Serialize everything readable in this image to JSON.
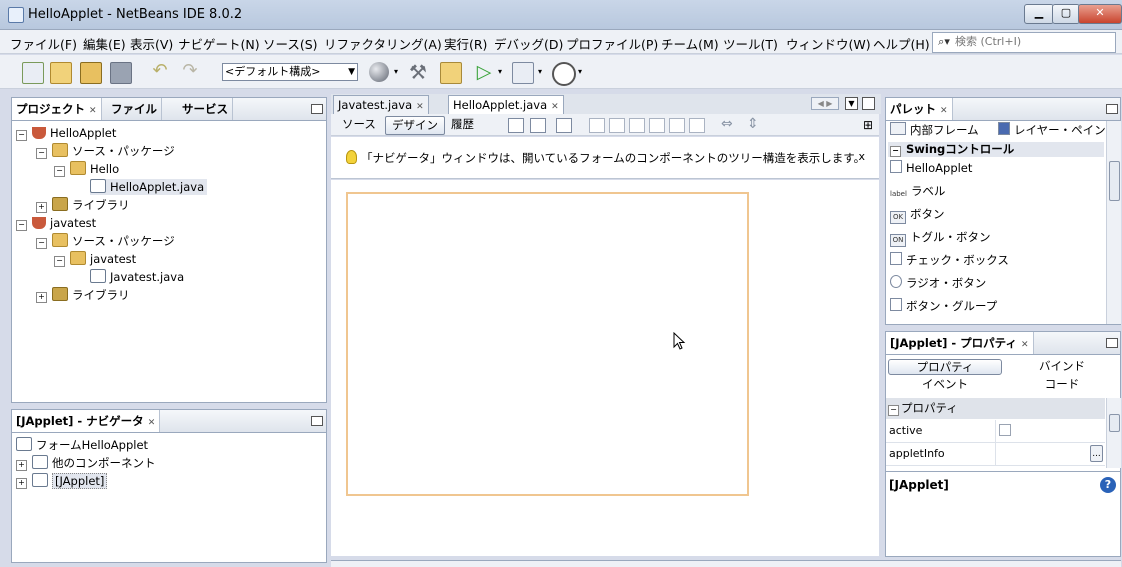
{
  "window": {
    "title": "HelloApplet - NetBeans IDE 8.0.2",
    "controls": {
      "minimize": "▁",
      "maximize": "▢",
      "close": "✕"
    }
  },
  "menubar": {
    "items": [
      "ファイル(F)",
      "編集(E)",
      "表示(V)",
      "ナビゲート(N)",
      "ソース(S)",
      "リファクタリング(A)",
      "実行(R)",
      "デバッグ(D)",
      "プロファイル(P)",
      "チーム(M)",
      "ツール(T)",
      "ウィンドウ(W)",
      "ヘルプ(H)"
    ],
    "search_placeholder": "検索 (Ctrl+I)"
  },
  "toolbar": {
    "config_selected": "<デフォルト構成>",
    "icons": [
      "new-file-icon",
      "new-project-icon",
      "open-project-icon",
      "save-all-icon",
      "undo-icon",
      "redo-icon",
      "browser-icon",
      "build-icon",
      "clean-build-icon",
      "run-icon",
      "debug-icon",
      "profile-icon"
    ]
  },
  "projects_panel": {
    "tabs": [
      "プロジェクト",
      "ファイル",
      "サービス"
    ],
    "tree": {
      "p1": "HelloApplet",
      "p1_src": "ソース・パッケージ",
      "p1_pkg": "Hello",
      "p1_file": "HelloApplet.java",
      "p1_lib": "ライブラリ",
      "p2": "javatest",
      "p2_src": "ソース・パッケージ",
      "p2_pkg": "javatest",
      "p2_file": "Javatest.java",
      "p2_lib": "ライブラリ"
    }
  },
  "navigator_panel": {
    "title": "[JApplet] - ナビゲータ",
    "tree": {
      "root": "フォームHelloApplet",
      "others": "他のコンポーネント",
      "japplet": "[JApplet]"
    }
  },
  "editor": {
    "tabs": [
      "Javatest.java",
      "HelloApplet.java"
    ],
    "active_tab": "HelloApplet.java",
    "views": [
      "ソース",
      "デザイン",
      "履歴"
    ],
    "active_view": "デザイン",
    "hint": "「ナビゲータ」ウィンドウは、開いているフォームのコンポーネントのツリー構造を表示します。",
    "hint_close": "x"
  },
  "palette_panel": {
    "title": "パレット",
    "top_items": [
      "内部フレーム",
      "レイヤー・ペイン"
    ],
    "category": "Swingコントロール",
    "items": [
      {
        "label": "HelloApplet",
        "icon": "file-icon"
      },
      {
        "label": "ラベル",
        "icon": "label-icon"
      },
      {
        "label": "ボタン",
        "icon": "button-icon"
      },
      {
        "label": "トグル・ボタン",
        "icon": "toggle-icon"
      },
      {
        "label": "チェック・ボックス",
        "icon": "checkbox-icon"
      },
      {
        "label": "ラジオ・ボタン",
        "icon": "radio-icon"
      },
      {
        "label": "ボタン・グループ",
        "icon": "button-group-icon"
      }
    ],
    "icon_text": {
      "label": "label",
      "button": "OK",
      "toggle": "ON"
    }
  },
  "properties_panel": {
    "title": "[JApplet] - プロパティ",
    "tabs": [
      "プロパティ",
      "バインド",
      "イベント",
      "コード"
    ],
    "active_tab": "プロパティ",
    "section": "プロパティ",
    "rows": [
      {
        "name": "active",
        "value": ""
      },
      {
        "name": "appletInfo",
        "value": ""
      }
    ],
    "more_button": "...",
    "footer": "[JApplet]"
  },
  "colors": {
    "accent": "#9aa8bd",
    "form_border": "#f0c690",
    "help": "#2a62b8"
  }
}
